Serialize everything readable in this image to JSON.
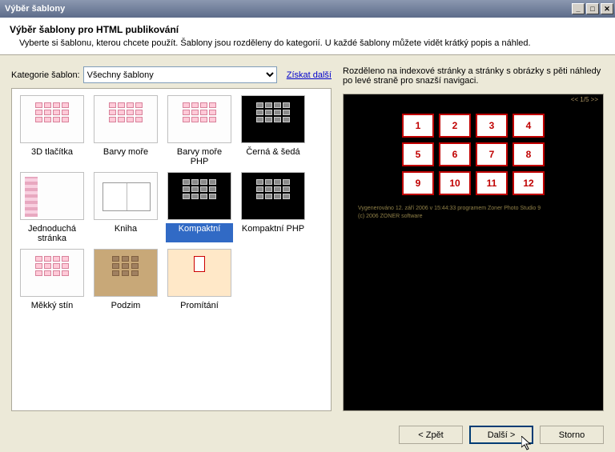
{
  "window": {
    "title": "Výběr šablony"
  },
  "header": {
    "title": "Výběr šablony pro HTML publikování",
    "subtitle": "Vyberte si šablonu, kterou chcete použít. Šablony jsou rozděleny do kategorií. U každé šablony můžete vidět krátký popis a náhled."
  },
  "category": {
    "label": "Kategorie šablon:",
    "selected": "Všechny šablony",
    "get_more": "Získat další"
  },
  "templates": [
    {
      "label": "3D tlačítka",
      "variant": "light"
    },
    {
      "label": "Barvy moře",
      "variant": "light"
    },
    {
      "label": "Barvy moře PHP",
      "variant": "light"
    },
    {
      "label": "Černá & šedá",
      "variant": "dark"
    },
    {
      "label": "Jednoduchá stránka",
      "variant": "strip"
    },
    {
      "label": "Kniha",
      "variant": "book"
    },
    {
      "label": "Kompaktní",
      "variant": "dark",
      "selected": true
    },
    {
      "label": "Kompaktní PHP",
      "variant": "dark"
    },
    {
      "label": "Měkký stín",
      "variant": "light"
    },
    {
      "label": "Podzim",
      "variant": "brown"
    },
    {
      "label": "Promítání",
      "variant": "peach-proj"
    }
  ],
  "description": "Rozděleno na indexové stránky a stránky s obrázky s pěti náhledy po levé straně pro snazší navigaci.",
  "preview": {
    "pager": "<< 1/5 >>",
    "cells": [
      "1",
      "2",
      "3",
      "4",
      "5",
      "6",
      "7",
      "8",
      "9",
      "10",
      "11",
      "12"
    ],
    "footer1": "Vygenerováno 12. září 2006 v 15:44:33 programem Zoner Photo Studio 9",
    "footer2": "(c) 2006 ZONER software"
  },
  "buttons": {
    "back": "< Zpět",
    "next": "Další >",
    "cancel": "Storno"
  }
}
